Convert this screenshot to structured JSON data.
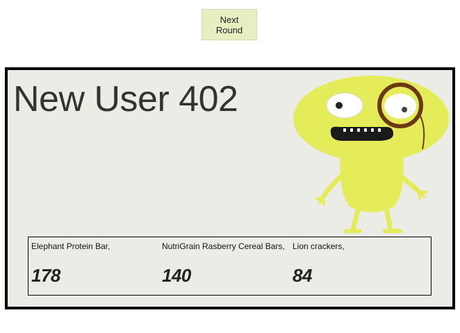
{
  "controls": {
    "next_round_label": "Next Round"
  },
  "card": {
    "username": "New User 402",
    "avatar_icon": "yellow-monster-with-monocle",
    "foods": [
      {
        "label": "Elephant Protein Bar,",
        "value": "178"
      },
      {
        "label": "NutriGrain Rasberry Cereal Bars,",
        "value": "140"
      },
      {
        "label": "Lion crackers,",
        "value": "84"
      }
    ]
  },
  "colors": {
    "button_bg": "#e6efc2",
    "card_bg": "#ecece6",
    "monster_body": "#e4ec5a",
    "monocle": "#6b3a12"
  }
}
